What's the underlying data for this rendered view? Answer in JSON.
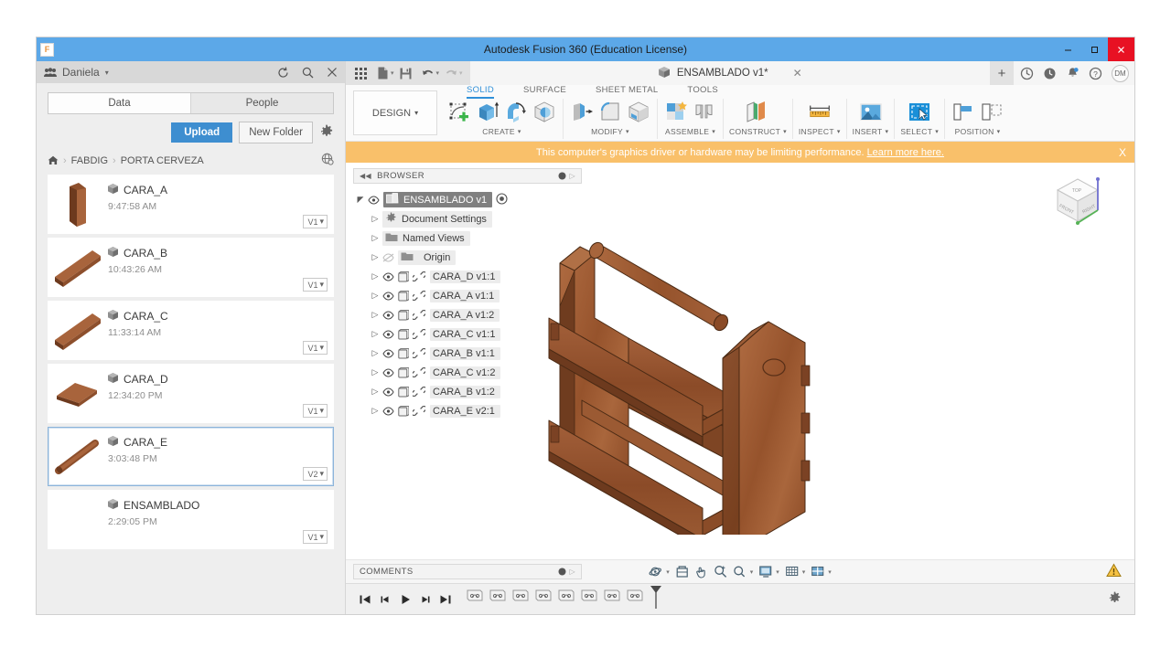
{
  "window": {
    "title": "Autodesk Fusion 360 (Education License)",
    "logo_text": "F",
    "minimize_label": "–",
    "maximize_label": "❑",
    "close_label": "✕"
  },
  "data_panel": {
    "user_name": "Daniela",
    "user_caret": "▾",
    "icons": {
      "refresh": "refresh-icon",
      "search": "search-icon",
      "close": "close-icon"
    },
    "tabs": [
      {
        "label": "Data",
        "active": true
      },
      {
        "label": "People",
        "active": false
      }
    ],
    "upload_label": "Upload",
    "new_folder_label": "New Folder",
    "breadcrumb": {
      "home": "⌂",
      "items": [
        "FABDIG",
        "PORTA CERVEZA"
      ],
      "separator": "›"
    },
    "items": [
      {
        "name": "CARA_A",
        "time": "9:47:58 AM",
        "version": "V1",
        "selected": false,
        "thumb": "panel-tall"
      },
      {
        "name": "CARA_B",
        "time": "10:43:26 AM",
        "version": "V1",
        "selected": false,
        "thumb": "slat"
      },
      {
        "name": "CARA_C",
        "time": "11:33:14 AM",
        "version": "V1",
        "selected": false,
        "thumb": "slat"
      },
      {
        "name": "CARA_D",
        "time": "12:34:20 PM",
        "version": "V1",
        "selected": false,
        "thumb": "base"
      },
      {
        "name": "CARA_E",
        "time": "3:03:48 PM",
        "version": "V2",
        "selected": true,
        "thumb": "dowel"
      },
      {
        "name": "ENSAMBLADO",
        "time": "2:29:05 PM",
        "version": "V1",
        "selected": false,
        "thumb": "none"
      }
    ],
    "version_caret": "▾"
  },
  "quick_access": {
    "icons": [
      "grid-apps-icon",
      "file-new-icon",
      "save-icon",
      "undo-icon",
      "redo-icon"
    ],
    "caret": "▾",
    "document_tab": {
      "label": "ENSAMBLADO v1*",
      "close": "✕"
    },
    "add_tab": "+",
    "right_icons": [
      "job-status-icon",
      "recent-icon",
      "notifications-icon",
      "help-icon"
    ],
    "avatar_initials": "DM"
  },
  "ribbon": {
    "design_label": "DESIGN",
    "design_caret": "▾",
    "tabs": [
      {
        "label": "SOLID",
        "active": true
      },
      {
        "label": "SURFACE",
        "active": false
      },
      {
        "label": "SHEET METAL",
        "active": false
      },
      {
        "label": "TOOLS",
        "active": false
      }
    ],
    "groups": [
      {
        "label": "CREATE",
        "caret": "▾",
        "icons": [
          "create-sketch-icon",
          "extrude-icon",
          "revolve-icon",
          "sphere-icon"
        ]
      },
      {
        "label": "MODIFY",
        "caret": "▾",
        "icons": [
          "press-pull-icon",
          "fillet-icon",
          "shell-icon"
        ]
      },
      {
        "label": "ASSEMBLE",
        "caret": "▾",
        "icons": [
          "new-component-icon",
          "joint-icon"
        ]
      },
      {
        "label": "CONSTRUCT",
        "caret": "▾",
        "icons": [
          "construct-plane-icon"
        ]
      },
      {
        "label": "INSPECT",
        "caret": "▾",
        "icons": [
          "measure-icon"
        ]
      },
      {
        "label": "INSERT",
        "caret": "▾",
        "icons": [
          "insert-image-icon"
        ]
      },
      {
        "label": "SELECT",
        "caret": "▾",
        "icons": [
          "select-window-icon"
        ]
      },
      {
        "label": "POSITION",
        "caret": "▾",
        "icons": [
          "align-icon",
          "move-copy-icon"
        ]
      }
    ]
  },
  "warning_banner": {
    "message": "This computer's graphics driver or hardware may be limiting performance.",
    "link_text": "Learn more here.",
    "close": "X",
    "color": "#f9c06a"
  },
  "browser": {
    "header_label": "BROWSER",
    "collapse": "◀◀",
    "nodes": [
      {
        "label": "ENSAMBLADO v1",
        "level": 0,
        "root": true,
        "has_eye": true,
        "has_box": false,
        "has_link": false,
        "icon": "component-icon",
        "radio": true
      },
      {
        "label": "Document Settings",
        "level": 1,
        "root": false,
        "has_eye": false,
        "has_box": false,
        "has_link": false,
        "icon": "gear-icon"
      },
      {
        "label": "Named Views",
        "level": 1,
        "root": false,
        "has_eye": false,
        "has_box": false,
        "has_link": false,
        "icon": "folder-icon"
      },
      {
        "label": "Origin",
        "level": 1,
        "root": false,
        "has_eye": true,
        "eye_off": true,
        "has_box": false,
        "has_link": false,
        "icon": "folder-icon"
      },
      {
        "label": "CARA_D v1:1",
        "level": 1,
        "root": false,
        "has_eye": true,
        "has_box": true,
        "has_link": true
      },
      {
        "label": "CARA_A v1:1",
        "level": 1,
        "root": false,
        "has_eye": true,
        "has_box": true,
        "has_link": true
      },
      {
        "label": "CARA_A v1:2",
        "level": 1,
        "root": false,
        "has_eye": true,
        "has_box": true,
        "has_link": true
      },
      {
        "label": "CARA_C v1:1",
        "level": 1,
        "root": false,
        "has_eye": true,
        "has_box": true,
        "has_link": true
      },
      {
        "label": "CARA_B v1:1",
        "level": 1,
        "root": false,
        "has_eye": true,
        "has_box": true,
        "has_link": true
      },
      {
        "label": "CARA_C v1:2",
        "level": 1,
        "root": false,
        "has_eye": true,
        "has_box": true,
        "has_link": true
      },
      {
        "label": "CARA_B v1:2",
        "level": 1,
        "root": false,
        "has_eye": true,
        "has_box": true,
        "has_link": true
      },
      {
        "label": "CARA_E v2:1",
        "level": 1,
        "root": false,
        "has_eye": true,
        "has_box": true,
        "has_link": true
      }
    ],
    "expand_arrow": "▷"
  },
  "viewcube": {
    "labels": [
      "TOP",
      "FRONT",
      "RIGHT"
    ],
    "axis_z_color": "#6f6fd0",
    "axis_y_color": "#56b356"
  },
  "model": {
    "name": "ENSAMBLADO",
    "description": "Wooden beer carrier assembly",
    "wood_light": "#a8643c",
    "wood_mid": "#8d4f2c",
    "wood_dark": "#6d3a1e"
  },
  "comments_bar": {
    "label": "COMMENTS"
  },
  "nav_tools": {
    "icons": [
      "orbit-icon",
      "look-at-icon",
      "pan-icon",
      "zoom-icon",
      "zoom-window-icon",
      "display-settings-icon",
      "grid-snaps-icon",
      "viewports-icon"
    ],
    "caret": "▾"
  },
  "status": {
    "warning_icon": "warning-triangle-icon",
    "settings_icon": "gear-icon"
  },
  "timeline": {
    "playback": [
      "jump-start-icon",
      "step-back-icon",
      "play-icon",
      "step-forward-icon",
      "jump-end-icon"
    ],
    "feature_count": 8,
    "feature_icon": "joint-feature-icon",
    "marker": "timeline-marker"
  }
}
